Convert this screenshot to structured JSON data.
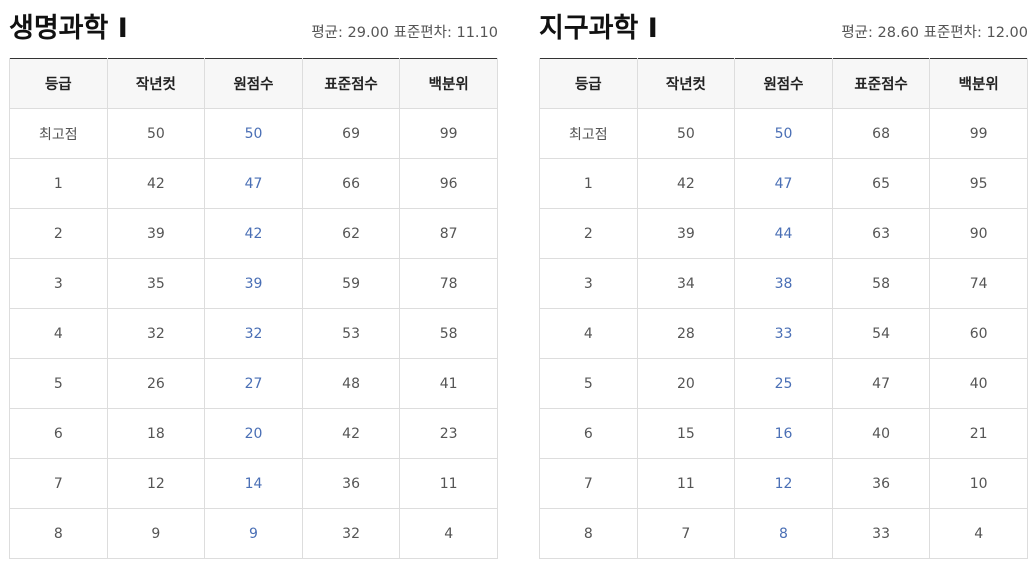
{
  "colors": {
    "raw_score_text": "#4a6fb5",
    "header_bg": "#f7f7f7",
    "border": "#dddddd",
    "top_border": "#333333"
  },
  "columns": [
    "등급",
    "작년컷",
    "원점수",
    "표준점수",
    "백분위"
  ],
  "panels": [
    {
      "title": "생명과학 Ⅰ",
      "stats": "평균: 29.00 표준편차: 11.10",
      "rows": [
        [
          "최고점",
          "50",
          "50",
          "69",
          "99"
        ],
        [
          "1",
          "42",
          "47",
          "66",
          "96"
        ],
        [
          "2",
          "39",
          "42",
          "62",
          "87"
        ],
        [
          "3",
          "35",
          "39",
          "59",
          "78"
        ],
        [
          "4",
          "32",
          "32",
          "53",
          "58"
        ],
        [
          "5",
          "26",
          "27",
          "48",
          "41"
        ],
        [
          "6",
          "18",
          "20",
          "42",
          "23"
        ],
        [
          "7",
          "12",
          "14",
          "36",
          "11"
        ],
        [
          "8",
          "9",
          "9",
          "32",
          "4"
        ]
      ]
    },
    {
      "title": "지구과학 Ⅰ",
      "stats": "평균: 28.60 표준편차: 12.00",
      "rows": [
        [
          "최고점",
          "50",
          "50",
          "68",
          "99"
        ],
        [
          "1",
          "42",
          "47",
          "65",
          "95"
        ],
        [
          "2",
          "39",
          "44",
          "63",
          "90"
        ],
        [
          "3",
          "34",
          "38",
          "58",
          "74"
        ],
        [
          "4",
          "28",
          "33",
          "54",
          "60"
        ],
        [
          "5",
          "20",
          "25",
          "47",
          "40"
        ],
        [
          "6",
          "15",
          "16",
          "40",
          "21"
        ],
        [
          "7",
          "11",
          "12",
          "36",
          "10"
        ],
        [
          "8",
          "7",
          "8",
          "33",
          "4"
        ]
      ]
    }
  ]
}
